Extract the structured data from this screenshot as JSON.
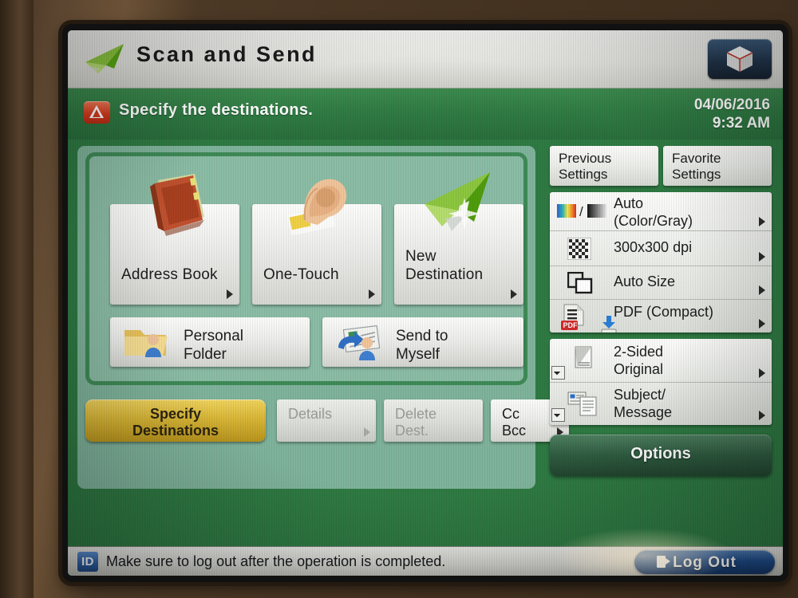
{
  "titlebar": {
    "title": "Scan and Send",
    "app_icon": "paper-plane-icon",
    "cube_button_icon": "cube-icon"
  },
  "statusbar": {
    "alert_icon": "warning-triangle-icon",
    "message": "Specify the destinations.",
    "date": "04/06/2016",
    "time": "9:32 AM"
  },
  "destinations": {
    "tiles": [
      {
        "label": "Address Book",
        "icon": "address-book-icon"
      },
      {
        "label": "One-Touch",
        "icon": "hand-touch-icon"
      },
      {
        "label": "New\nDestination",
        "line1": "New",
        "line2": "Destination",
        "icon": "paper-plane-icon"
      }
    ],
    "rows": [
      {
        "line1": "Personal",
        "line2": "Folder",
        "icon": "personal-folder-icon"
      },
      {
        "line1": "Send to",
        "line2": "Myself",
        "icon": "send-to-myself-icon"
      }
    ]
  },
  "actions": {
    "specify": {
      "line1": "Specify",
      "line2": "Destinations",
      "state": "selected"
    },
    "details": {
      "label": "Details",
      "state": "disabled"
    },
    "delete_dest": {
      "line1": "Delete",
      "line2": "Dest.",
      "state": "disabled"
    },
    "cc_bcc": {
      "line1": "Cc",
      "line2": "Bcc",
      "state": "enabled"
    }
  },
  "settings": {
    "previous_settings": {
      "line1": "Previous",
      "line2": "Settings"
    },
    "favorite_settings": {
      "line1": "Favorite",
      "line2": "Settings"
    },
    "card_a": [
      {
        "line1": "Auto",
        "line2": "(Color/Gray)",
        "icon": "color-gray-mode-icon"
      },
      {
        "line1": "300x300 dpi",
        "line2": "",
        "icon": "resolution-checker-icon"
      },
      {
        "line1": "Auto Size",
        "line2": "",
        "icon": "paper-size-icon"
      },
      {
        "line1": "PDF (Compact)",
        "line2": "",
        "icon": "pdf-file-icon"
      }
    ],
    "card_b": [
      {
        "line1": "2-Sided",
        "line2": "Original",
        "icon": "two-sided-original-icon"
      },
      {
        "line1": "Subject/",
        "line2": "Message",
        "icon": "subject-message-icon"
      }
    ],
    "options_label": "Options"
  },
  "footer": {
    "id_badge": "ID",
    "message": "Make sure to log out after the operation is completed.",
    "logout_label": "Log Out"
  },
  "colors": {
    "screen_green": "#2f7a43",
    "panel_green": "#8bbca5",
    "selected_gold": "#d8b637",
    "accent_blue": "#1f4e8d",
    "alert_red": "#d83c20"
  }
}
